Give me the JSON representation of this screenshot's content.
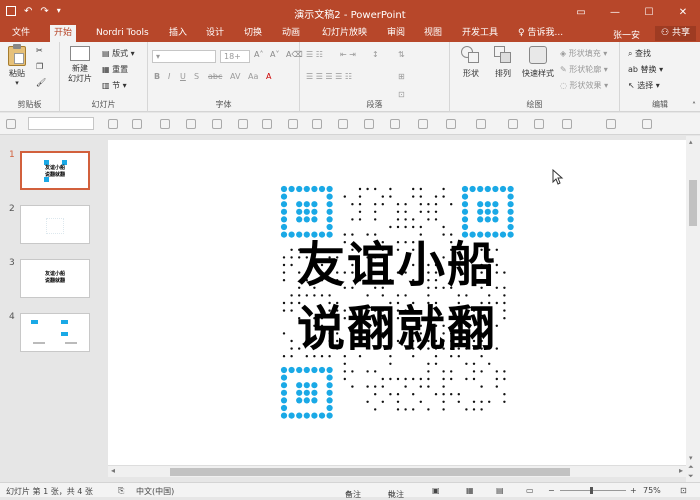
{
  "window": {
    "title": "演示文稿2 - PowerPoint"
  },
  "tabs": [
    "文件",
    "开始",
    "Nordri Tools",
    "插入",
    "设计",
    "切换",
    "动画",
    "幻灯片放映",
    "审阅",
    "视图",
    "开发工具"
  ],
  "tell_me": "告诉我...",
  "user": "张一安",
  "share": "共享",
  "ribbon": {
    "clipboard": {
      "paste": "粘贴",
      "label": "剪贴板"
    },
    "slides": {
      "new_slide": "新建\n幻灯片",
      "layout": "版式",
      "reset": "重置",
      "section": "节",
      "label": "幻灯片"
    },
    "font": {
      "size": "18+",
      "label": "字体"
    },
    "paragraph": {
      "label": "段落"
    },
    "drawing": {
      "shape": "形状",
      "arrange": "排列",
      "quick_style": "快速样式",
      "fill": "形状填充",
      "outline": "形状轮廓",
      "effect": "形状效果",
      "label": "绘图"
    },
    "editing": {
      "find": "查找",
      "replace": "替换",
      "select": "选择",
      "label": "编辑"
    }
  },
  "thumbnails": [
    {
      "num": "1",
      "lines": [
        "友谊小船",
        "说翻就翻"
      ]
    },
    {
      "num": "2",
      "lines": []
    },
    {
      "num": "3",
      "lines": [
        "友谊小船",
        "说翻就翻"
      ]
    },
    {
      "num": "4",
      "lines": []
    }
  ],
  "slide": {
    "line1": "友谊小船",
    "line2": "说翻就翻"
  },
  "status": {
    "slide_info": "幻灯片 第 1 张，共 4 张",
    "language": "中文(中国)",
    "notes": "备注",
    "comments": "批注",
    "zoom": "75%"
  },
  "colors": {
    "accent": "#b7472a",
    "qr_blue": "#1aa9e6"
  }
}
